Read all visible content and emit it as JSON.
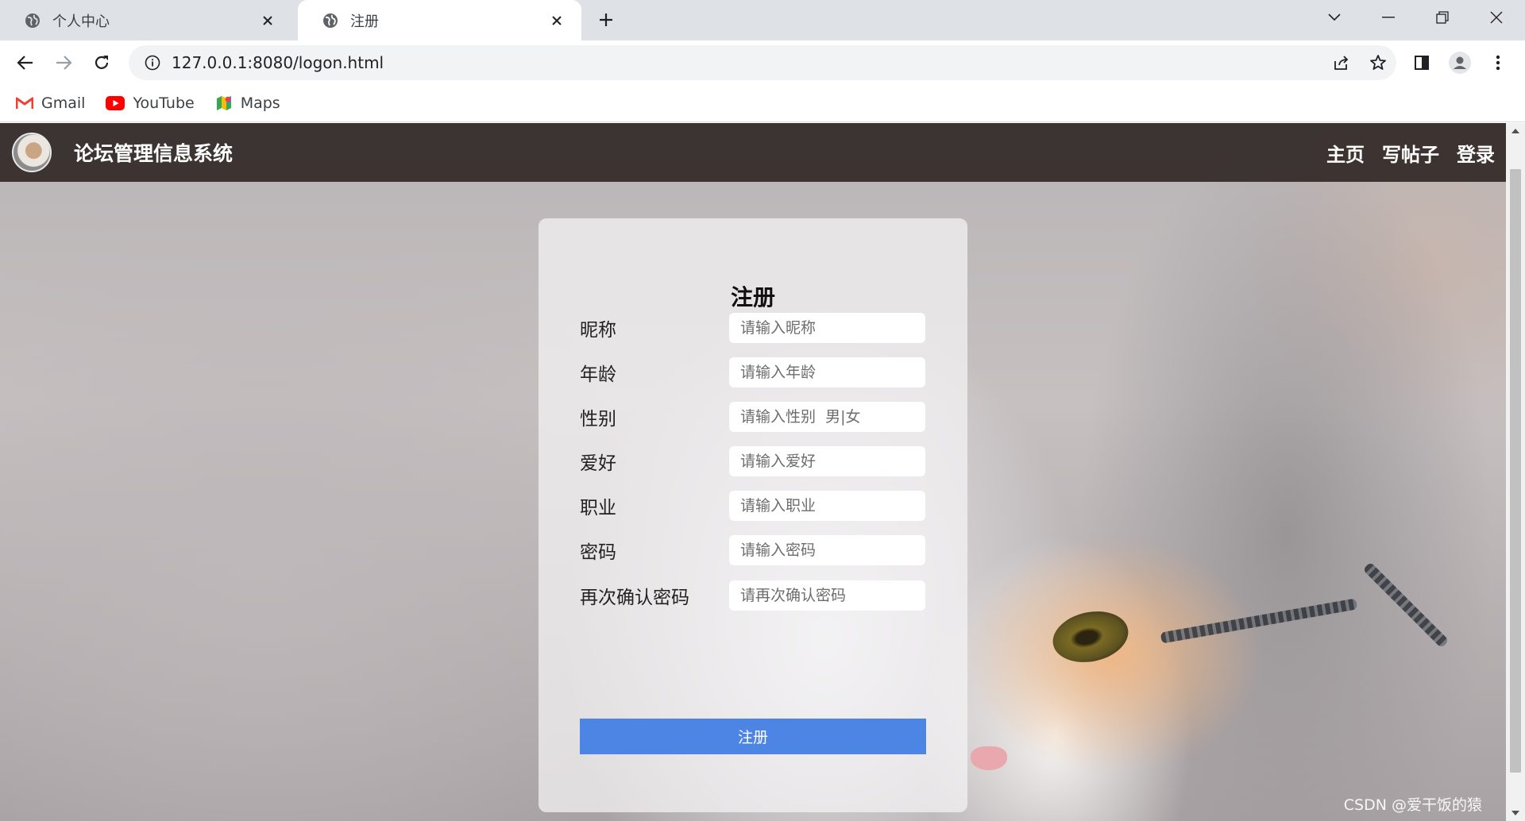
{
  "browser": {
    "tabs": [
      {
        "title": "个人中心",
        "icon": "globe-icon",
        "active": false
      },
      {
        "title": "注册",
        "icon": "globe-icon",
        "active": true
      }
    ],
    "url": "127.0.0.1:8080/logon.html",
    "bookmarks": [
      {
        "label": "Gmail",
        "icon": "gmail-icon"
      },
      {
        "label": "YouTube",
        "icon": "youtube-icon"
      },
      {
        "label": "Maps",
        "icon": "maps-icon"
      }
    ]
  },
  "site": {
    "title": "论坛管理信息系统",
    "nav": [
      "主页",
      "写帖子",
      "登录"
    ]
  },
  "form": {
    "title": "注册",
    "fields": [
      {
        "label": "昵称",
        "placeholder": "请输入昵称"
      },
      {
        "label": "年龄",
        "placeholder": "请输入年龄"
      },
      {
        "label": "性别",
        "placeholder": "请输入性别  男|女"
      },
      {
        "label": "爱好",
        "placeholder": "请输入爱好"
      },
      {
        "label": "职业",
        "placeholder": "请输入职业"
      },
      {
        "label": "密码",
        "placeholder": "请输入密码"
      },
      {
        "label": "再次确认密码",
        "placeholder": "请再次确认密码"
      }
    ],
    "submit_label": "注册"
  },
  "watermark": "CSDN @爱干饭的猿",
  "colors": {
    "submit": "#4c85e3",
    "header": "#281e1c",
    "tabstrip": "#dee1e6"
  }
}
